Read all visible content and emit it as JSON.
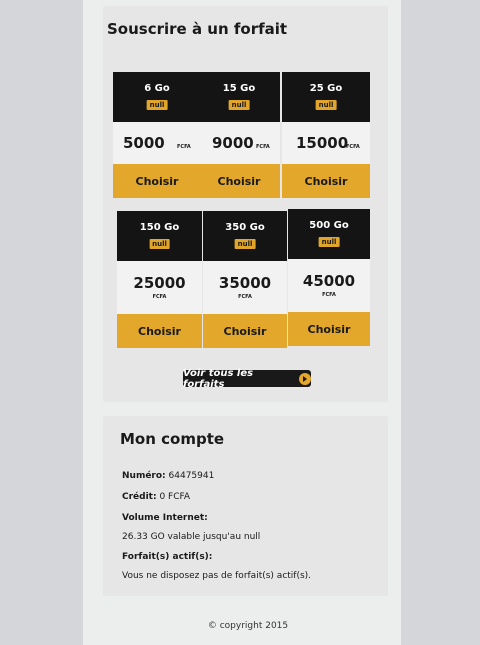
{
  "subscribe": {
    "title": "Souscrire à un forfait",
    "plans": [
      {
        "gb": "6 Go",
        "badge": "null",
        "price": "5000",
        "currency": "FCFA",
        "button": "Choisir"
      },
      {
        "gb": "15 Go",
        "badge": "null",
        "price": "9000",
        "currency": "FCFA",
        "button": "Choisir"
      },
      {
        "gb": "25 Go",
        "badge": "null",
        "price": "15000",
        "currency": "FCFA",
        "button": "Choisir"
      },
      {
        "gb": "150 Go",
        "badge": "null",
        "price": "25000",
        "currency": "FCFA",
        "button": "Choisir"
      },
      {
        "gb": "350 Go",
        "badge": "null",
        "price": "35000",
        "currency": "FCFA",
        "button": "Choisir"
      },
      {
        "gb": "500 Go",
        "badge": "null",
        "price": "45000",
        "currency": "FCFA",
        "button": "Choisir"
      }
    ],
    "all_plans_label": "Voir tous les forfaits"
  },
  "account": {
    "title": "Mon compte",
    "number_label": "Numéro:",
    "number_value": "64475941",
    "credit_label": "Crédit:",
    "credit_value": "0 FCFA",
    "internet_label": "Volume Internet:",
    "internet_value": "26.33 GO valable jusqu'au null",
    "active_label": "Forfait(s) actif(s):",
    "active_value": "Vous ne disposez pas de forfait(s) actif(s)."
  },
  "footer": {
    "copyright": "© copyright 2015"
  },
  "colors": {
    "accent": "#e2a72b",
    "dark": "#141414"
  }
}
